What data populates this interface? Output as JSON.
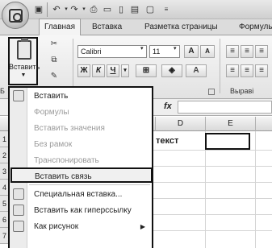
{
  "tabs": {
    "home": "Главная",
    "insert": "Вставка",
    "page_layout": "Разметка страницы",
    "formulas": "Формулы"
  },
  "ribbon": {
    "paste_label": "Вставить",
    "font_name": "Calibri",
    "font_size": "11",
    "bold": "Ж",
    "italic": "К",
    "underline": "Ч",
    "grow_font": "A",
    "shrink_font": "A",
    "clipboard_group": "Б",
    "align_group": "Выраві"
  },
  "formula_bar": {
    "fx": "fx"
  },
  "grid": {
    "columns": [
      "D",
      "E"
    ],
    "rows": [
      "1",
      "2",
      "3",
      "4",
      "5",
      "6",
      "7"
    ],
    "cell_text": "текст"
  },
  "menu": {
    "items": [
      {
        "label": "Вставить",
        "enabled": true
      },
      {
        "label": "Формулы",
        "enabled": false
      },
      {
        "label": "Вставить значения",
        "enabled": false
      },
      {
        "label": "Без рамок",
        "enabled": false
      },
      {
        "label": "Транспонировать",
        "enabled": false
      },
      {
        "label": "Вставить связь",
        "enabled": true
      },
      {
        "label": "Специальная вставка...",
        "enabled": true
      },
      {
        "label": "Вставить как гиперссылку",
        "enabled": true
      },
      {
        "label": "Как рисунок",
        "enabled": true
      }
    ]
  }
}
